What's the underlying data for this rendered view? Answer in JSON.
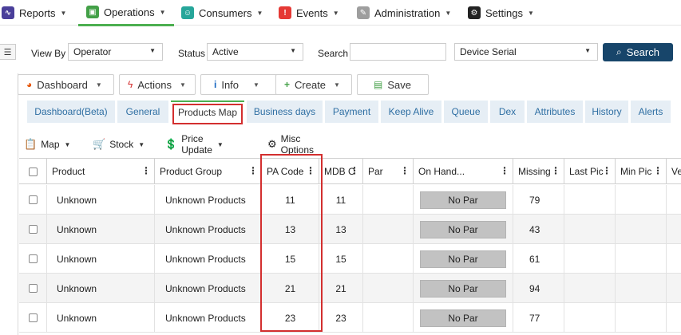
{
  "topnav": {
    "items": [
      {
        "label": "Reports",
        "icon": "reports-icon",
        "color": "#4a3f9a"
      },
      {
        "label": "Operations",
        "icon": "operations-icon",
        "color": "#43a047",
        "active": true
      },
      {
        "label": "Consumers",
        "icon": "consumers-icon",
        "color": "#26a69a"
      },
      {
        "label": "Events",
        "icon": "events-icon",
        "color": "#e53935"
      },
      {
        "label": "Administration",
        "icon": "administration-icon",
        "color": "#9e9e9e"
      },
      {
        "label": "Settings",
        "icon": "settings-icon",
        "color": "#222222"
      }
    ]
  },
  "filters": {
    "view_by_label": "View By",
    "view_by_value": "Operator",
    "status_label": "Status",
    "status_value": "Active",
    "search_label": "Search",
    "search_value": "",
    "field_value": "Device Serial",
    "search_button": "Search"
  },
  "actions": {
    "dashboard": "Dashboard",
    "actions": "Actions",
    "info": "Info",
    "create": "Create",
    "save": "Save"
  },
  "tabs": [
    "Dashboard(Beta)",
    "General",
    "Products Map",
    "Business days",
    "Payment",
    "Keep Alive",
    "Queue",
    "Dex",
    "Attributes",
    "History",
    "Alerts"
  ],
  "toolbar2": {
    "map": "Map",
    "stock": "Stock",
    "price_update": "Price Update",
    "misc_options": "Misc Options"
  },
  "grid": {
    "headers": [
      "Product",
      "Product Group",
      "PA Code",
      "MDB C",
      "Par",
      "On Hand...",
      "Missing",
      "Last Pic",
      "Min Pic",
      "Ve"
    ],
    "rows": [
      {
        "product": "Unknown",
        "group": "Unknown Products",
        "pa_code": "11",
        "mdb": "11",
        "par": "",
        "on_hand": "No Par",
        "missing": "79"
      },
      {
        "product": "Unknown",
        "group": "Unknown Products",
        "pa_code": "13",
        "mdb": "13",
        "par": "",
        "on_hand": "No Par",
        "missing": "43"
      },
      {
        "product": "Unknown",
        "group": "Unknown Products",
        "pa_code": "15",
        "mdb": "15",
        "par": "",
        "on_hand": "No Par",
        "missing": "61"
      },
      {
        "product": "Unknown",
        "group": "Unknown Products",
        "pa_code": "21",
        "mdb": "21",
        "par": "",
        "on_hand": "No Par",
        "missing": "94"
      },
      {
        "product": "Unknown",
        "group": "Unknown Products",
        "pa_code": "23",
        "mdb": "23",
        "par": "",
        "on_hand": "No Par",
        "missing": "77"
      }
    ]
  }
}
